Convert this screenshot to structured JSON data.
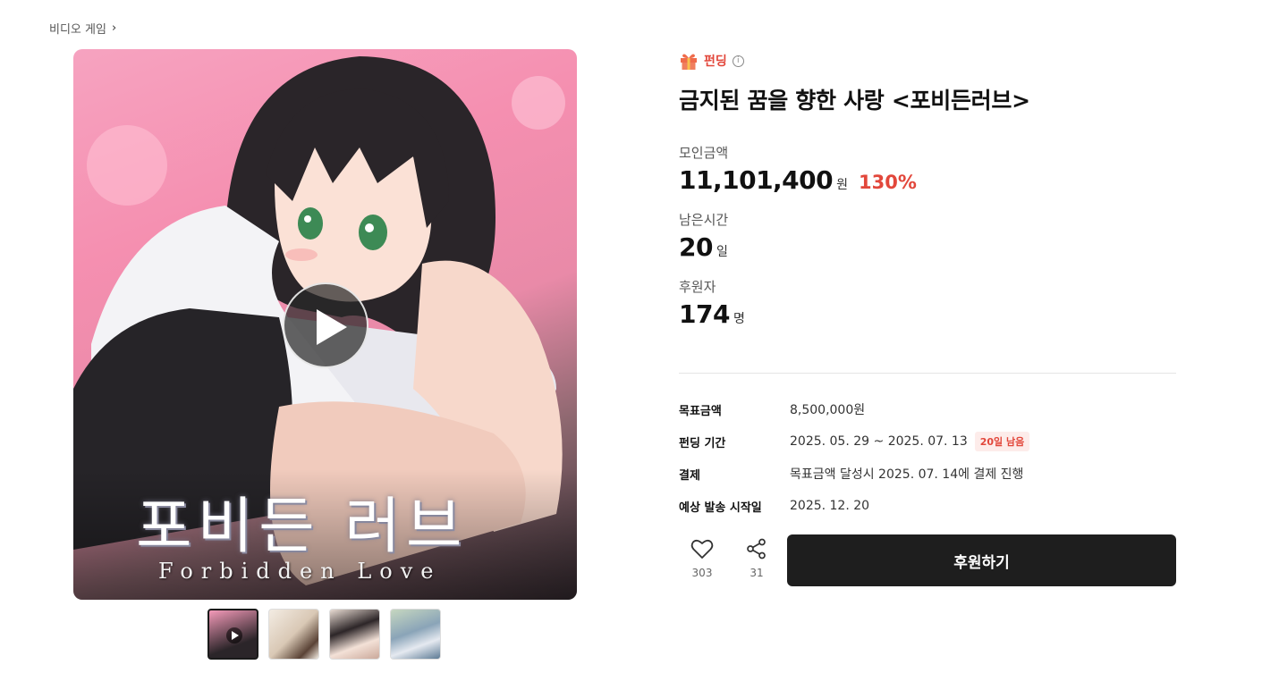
{
  "breadcrumb": {
    "label": "비디오 게임"
  },
  "media": {
    "title_art": "포비든 러브",
    "title_art_sub": "Forbidden Love",
    "thumbnails": [
      "thumb-1",
      "thumb-2",
      "thumb-3",
      "thumb-4"
    ]
  },
  "project": {
    "tag": "펀딩",
    "title": "금지된 꿈을 향한 사랑 <포비든러브>"
  },
  "stats": {
    "raised_label": "모인금액",
    "raised_value": "11,101,400",
    "raised_unit": "원",
    "raised_percent": "130%",
    "remaining_label": "남은시간",
    "remaining_value": "20",
    "remaining_unit": "일",
    "backers_label": "후원자",
    "backers_value": "174",
    "backers_unit": "명"
  },
  "details": {
    "goal_label": "목표금액",
    "goal_value": "8,500,000원",
    "period_label": "펀딩 기간",
    "period_value": "2025. 05. 29 ~ 2025. 07. 13",
    "period_badge": "20일 남음",
    "payment_label": "결제",
    "payment_value": "목표금액 달성시 2025. 07. 14에 결제 진행",
    "shipping_label": "예상 발송 시작일",
    "shipping_value": "2025. 12. 20"
  },
  "actions": {
    "like_count": "303",
    "share_count": "31",
    "support_label": "후원하기"
  },
  "colors": {
    "accent": "#e2473b",
    "button": "#1e1e1e"
  }
}
